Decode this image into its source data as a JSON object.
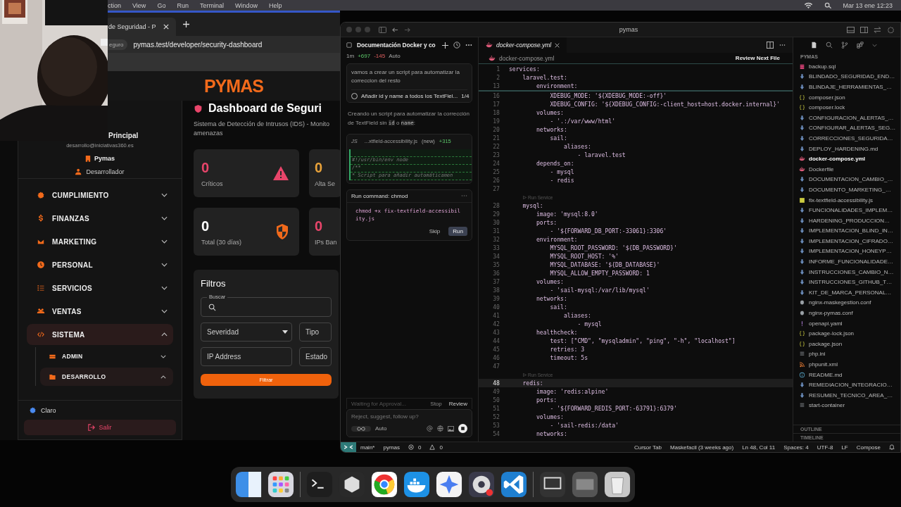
{
  "menubar": {
    "items": [
      "ction",
      "View",
      "Go",
      "Run",
      "Terminal",
      "Window",
      "Help"
    ],
    "clock": "Mar 13 ene 12:23"
  },
  "browser": {
    "tab": {
      "title": "de Seguridad - P"
    },
    "security_chip": "eguro",
    "url": "pymas.test/developer/security-dashboard",
    "page": {
      "logo": "PYMAS",
      "user": {
        "name": "Principal",
        "email": "desarrollo@iniciativas360.es",
        "company": "Pymas",
        "role": "Desarrollador"
      },
      "nav": [
        {
          "label": "CUMPLIMIENTO",
          "expanded": false
        },
        {
          "label": "FINANZAS",
          "expanded": false
        },
        {
          "label": "MARKETING",
          "expanded": false
        },
        {
          "label": "PERSONAL",
          "expanded": false
        },
        {
          "label": "SERVICIOS",
          "expanded": false
        },
        {
          "label": "VENTAS",
          "expanded": false
        },
        {
          "label": "SISTEMA",
          "expanded": true,
          "children": [
            {
              "label": "ADMIN",
              "expanded": false
            },
            {
              "label": "DESARROLLO",
              "expanded": true
            }
          ]
        }
      ],
      "theme": "Claro",
      "logout": "Salir",
      "title": "Dashboard de Seguri",
      "subtitle_lines": [
        "Sistema de Detección de Intrusos (IDS) - Monito",
        "amenazas"
      ],
      "stats": [
        {
          "value": "0",
          "label": "Críticos",
          "color": "#e8456a"
        },
        {
          "value": "0",
          "label": "Alta Se",
          "color": "#e8a23a"
        },
        {
          "value": "0",
          "label": "Total (30 días)",
          "color": "#ffffff"
        },
        {
          "value": "0",
          "label": "IPs Ban",
          "color": "#e8456a"
        }
      ],
      "filters": {
        "title": "Filtros",
        "search_label": "Buscar",
        "severity": "Severidad",
        "type": "Tipo",
        "ip": "IP Address",
        "status": "Estado",
        "button": "Filtrar"
      }
    }
  },
  "editor_window": {
    "title": "pymas",
    "chat": {
      "title": "Documentación Docker y co",
      "age": "1m",
      "added": "+697",
      "removed": "-145",
      "mode": "Auto",
      "user_message": "vamos a crear un script para automatizar la correccion del resto",
      "todo": {
        "text": "Añadir id y name a todos los TextFiel...",
        "count": "1/4",
        "done": false
      },
      "reply": [
        {
          "text": "Creando un script para automatizar la corrección de TextField sin ",
          "code": false
        },
        {
          "text": "id",
          "code": true
        },
        {
          "text": " o ",
          "code": false
        },
        {
          "text": "name",
          "code": true
        },
        {
          "text": ":",
          "code": false
        }
      ],
      "file_card": {
        "lang": "JS",
        "file": "...xtfield-accessibility.js",
        "status": "(new)",
        "added": "+315",
        "lines": [
          "#!/usr/bin/env node",
          "/**",
          "* Script para añadir automáticamen"
        ]
      },
      "command": {
        "title": "Run command: chmod",
        "text": "chmod +x fix-textfield-accessibility.js",
        "skip": "Skip",
        "run": "Run"
      },
      "waiting": "Waiting for Approval...",
      "stop": "Stop",
      "review": "Review",
      "placeholder": "Reject, suggest, follow up?",
      "model": "Auto"
    },
    "editor": {
      "tab": "docker-compose.yml",
      "breadcrumb": "docker-compose.yml",
      "review_next": "Review Next File",
      "sticky": [
        {
          "n": "1",
          "text": "services:"
        },
        {
          "n": "2",
          "text": "    laravel.test:"
        },
        {
          "n": "13",
          "text": "        environment:"
        }
      ],
      "lines": [
        {
          "kind": "code",
          "n": "16",
          "text": "            XDEBUG_MODE: '${XDEBUG_MODE:-off}'",
          "current": false
        },
        {
          "kind": "code",
          "n": "17",
          "text": "            XDEBUG_CONFIG: '${XDEBUG_CONFIG:-client_host=host.docker.internal}'",
          "current": false
        },
        {
          "kind": "code",
          "n": "18",
          "text": "        volumes:",
          "current": false
        },
        {
          "kind": "code",
          "n": "19",
          "text": "            - '.:/var/www/html'",
          "current": false
        },
        {
          "kind": "code",
          "n": "20",
          "text": "        networks:",
          "current": false
        },
        {
          "kind": "code",
          "n": "21",
          "text": "            sail:",
          "current": false
        },
        {
          "kind": "code",
          "n": "22",
          "text": "                aliases:",
          "current": false
        },
        {
          "kind": "code",
          "n": "23",
          "text": "                    - laravel.test",
          "current": false
        },
        {
          "kind": "code",
          "n": "24",
          "text": "        depends_on:",
          "current": false
        },
        {
          "kind": "code",
          "n": "25",
          "text": "            - mysql",
          "current": false
        },
        {
          "kind": "code",
          "n": "26",
          "text": "            - redis",
          "current": false
        },
        {
          "kind": "code",
          "n": "27",
          "current": false
        },
        {
          "kind": "lens",
          "text": "Run Service"
        },
        {
          "kind": "code",
          "n": "28",
          "text": "    mysql:",
          "current": false
        },
        {
          "kind": "code",
          "n": "29",
          "text": "        image: 'mysql:8.0'",
          "current": false
        },
        {
          "kind": "code",
          "n": "30",
          "text": "        ports:",
          "current": false
        },
        {
          "kind": "code",
          "n": "31",
          "text": "            - '${FORWARD_DB_PORT:-33061}:3306'",
          "current": false
        },
        {
          "kind": "code",
          "n": "32",
          "text": "        environment:",
          "current": false
        },
        {
          "kind": "code",
          "n": "33",
          "text": "            MYSQL_ROOT_PASSWORD: '${DB_PASSWORD}'",
          "current": false
        },
        {
          "kind": "code",
          "n": "34",
          "text": "            MYSQL_ROOT_HOST: '%'",
          "current": false
        },
        {
          "kind": "code",
          "n": "35",
          "text": "            MYSQL_DATABASE: '${DB_DATABASE}'",
          "current": false
        },
        {
          "kind": "code",
          "n": "36",
          "text": "            MYSQL_ALLOW_EMPTY_PASSWORD: 1",
          "current": false
        },
        {
          "kind": "code",
          "n": "37",
          "text": "        volumes:",
          "current": false
        },
        {
          "kind": "code",
          "n": "38",
          "text": "            - 'sail-mysql:/var/lib/mysql'",
          "current": false
        },
        {
          "kind": "code",
          "n": "39",
          "text": "        networks:",
          "current": false
        },
        {
          "kind": "code",
          "n": "40",
          "text": "            sail:",
          "current": false
        },
        {
          "kind": "code",
          "n": "41",
          "text": "                aliases:",
          "current": false
        },
        {
          "kind": "code",
          "n": "42",
          "text": "                    - mysql",
          "current": false
        },
        {
          "kind": "code",
          "n": "43",
          "text": "        healthcheck:",
          "current": false
        },
        {
          "kind": "code",
          "n": "44",
          "text": "            test: [\"CMD\", \"mysqladmin\", \"ping\", \"-h\", \"localhost\"]",
          "current": false
        },
        {
          "kind": "code",
          "n": "45",
          "text": "            retries: 3",
          "current": false
        },
        {
          "kind": "code",
          "n": "46",
          "text": "            timeout: 5s",
          "current": false
        },
        {
          "kind": "code",
          "n": "47",
          "current": false
        },
        {
          "kind": "lens",
          "text": "Run Service"
        },
        {
          "kind": "code",
          "n": "48",
          "text": "    redis:",
          "current": true
        },
        {
          "kind": "code",
          "n": "49",
          "text": "        image: 'redis:alpine'",
          "current": false
        },
        {
          "kind": "code",
          "n": "50",
          "text": "        ports:",
          "current": false
        },
        {
          "kind": "code",
          "n": "51",
          "text": "            - '${FORWARD_REDIS_PORT:-63791}:6379'",
          "current": false
        },
        {
          "kind": "code",
          "n": "52",
          "text": "        volumes:",
          "current": false
        },
        {
          "kind": "code",
          "n": "53",
          "text": "            - 'sail-redis:/data'",
          "current": false
        },
        {
          "kind": "code",
          "n": "54",
          "text": "        networks:",
          "current": false
        }
      ]
    },
    "explorer": {
      "root": "PYMAS",
      "files": [
        {
          "name": "backup.sql",
          "kind": "db",
          "selected": false
        },
        {
          "name": "BLINDADO_SEGURIDAD_END…",
          "kind": "md",
          "selected": false
        },
        {
          "name": "BLINDAJE_HERRAMIENTAS_…",
          "kind": "md",
          "selected": false
        },
        {
          "name": "composer.json",
          "kind": "json",
          "selected": false
        },
        {
          "name": "composer.lock",
          "kind": "json",
          "selected": false
        },
        {
          "name": "CONFIGURACION_ALERTAS_…",
          "kind": "md",
          "selected": false
        },
        {
          "name": "CONFIGURAR_ALERTAS_SEG…",
          "kind": "md",
          "selected": false
        },
        {
          "name": "CORRECCIONES_SEGURIDA…",
          "kind": "md",
          "selected": false
        },
        {
          "name": "DEPLOY_HARDENING.md",
          "kind": "md",
          "selected": false
        },
        {
          "name": "docker-compose.yml",
          "kind": "docker",
          "selected": true
        },
        {
          "name": "Dockerfile",
          "kind": "docker",
          "selected": false
        },
        {
          "name": "DOCUMENTACION_CAMBIO_…",
          "kind": "md",
          "selected": false
        },
        {
          "name": "DOCUMENTO_MARKETING_…",
          "kind": "md",
          "selected": false
        },
        {
          "name": "fix-textfield-accessibility.js",
          "kind": "js",
          "selected": false
        },
        {
          "name": "FUNCIONALIDADES_IMPLEM…",
          "kind": "md",
          "selected": false
        },
        {
          "name": "HARDENING_PRODUCCION…",
          "kind": "md",
          "selected": false
        },
        {
          "name": "IMPLEMENTACION_BLIND_IN…",
          "kind": "md",
          "selected": false
        },
        {
          "name": "IMPLEMENTACION_CIFRADO…",
          "kind": "md",
          "selected": false
        },
        {
          "name": "IMPLEMENTACION_HONEYP…",
          "kind": "md",
          "selected": false
        },
        {
          "name": "INFORME_FUNCIONALIDADE…",
          "kind": "md",
          "selected": false
        },
        {
          "name": "INSTRUCCIONES_CAMBIO_N…",
          "kind": "md",
          "selected": false
        },
        {
          "name": "INSTRUCCIONES_GITHUB_T…",
          "kind": "md",
          "selected": false
        },
        {
          "name": "KIT_DE_MARCA_PERSONAL…",
          "kind": "md",
          "selected": false
        },
        {
          "name": "nginx-maskegestion.conf",
          "kind": "gear",
          "selected": false
        },
        {
          "name": "nginx-pymas.conf",
          "kind": "gear",
          "selected": false
        },
        {
          "name": "openapi.yaml",
          "kind": "yaml",
          "selected": false
        },
        {
          "name": "package-lock.json",
          "kind": "json",
          "selected": false
        },
        {
          "name": "package.json",
          "kind": "json",
          "selected": false
        },
        {
          "name": "php.ini",
          "kind": "list",
          "selected": false
        },
        {
          "name": "phpunit.xml",
          "kind": "rss",
          "selected": false
        },
        {
          "name": "README.md",
          "kind": "info",
          "selected": false
        },
        {
          "name": "REMEDIACION_INTEGRACIO…",
          "kind": "md",
          "selected": false
        },
        {
          "name": "RESUMEN_TECNICO_AREA_…",
          "kind": "md",
          "selected": false
        },
        {
          "name": "start-container",
          "kind": "list",
          "selected": false
        }
      ],
      "sections": [
        "OUTLINE",
        "TIMELINE"
      ]
    },
    "status_bar": {
      "branch": "main*",
      "project": "pymas",
      "errors": "0",
      "warnings": "0",
      "cursor_tab": "Cursor Tab",
      "blame": "Maskefacil (3 weeks ago)",
      "position": "Ln 48, Col 11",
      "spaces": "Spaces: 4",
      "encoding": "UTF-8",
      "eol": "LF",
      "language": "Compose"
    }
  }
}
